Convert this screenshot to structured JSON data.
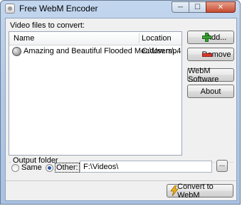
{
  "window": {
    "title": "Free WebM Encoder",
    "controls": {
      "minimize": "─",
      "maximize": "☐",
      "close": "✕"
    }
  },
  "files": {
    "label": "Video files to convert:",
    "columns": [
      "Name",
      "Location"
    ],
    "rows": [
      {
        "name": "Amazing and Beautiful Flooded Meadow.mp4",
        "location": "C:\\Users\\..."
      }
    ]
  },
  "buttons": {
    "add": "Add...",
    "remove": "Remove",
    "webm_software": "WebM Software",
    "about": "About",
    "browse": "...",
    "convert": "Convert to WebM"
  },
  "output": {
    "group_title": "Output folder",
    "same_label": "Same",
    "other_label": "Other:",
    "selected": "other",
    "path": "F:\\Videos\\"
  },
  "icons": {
    "app": "app-disc-icon",
    "file": "video-disc-icon",
    "add": "plus-icon",
    "remove": "minus-icon",
    "convert": "lightning-icon"
  },
  "colors": {
    "title_bar": "#b3cae6",
    "add_icon": "#3aa233",
    "remove_icon": "#d8382c",
    "convert_icon": "#f0b020"
  }
}
